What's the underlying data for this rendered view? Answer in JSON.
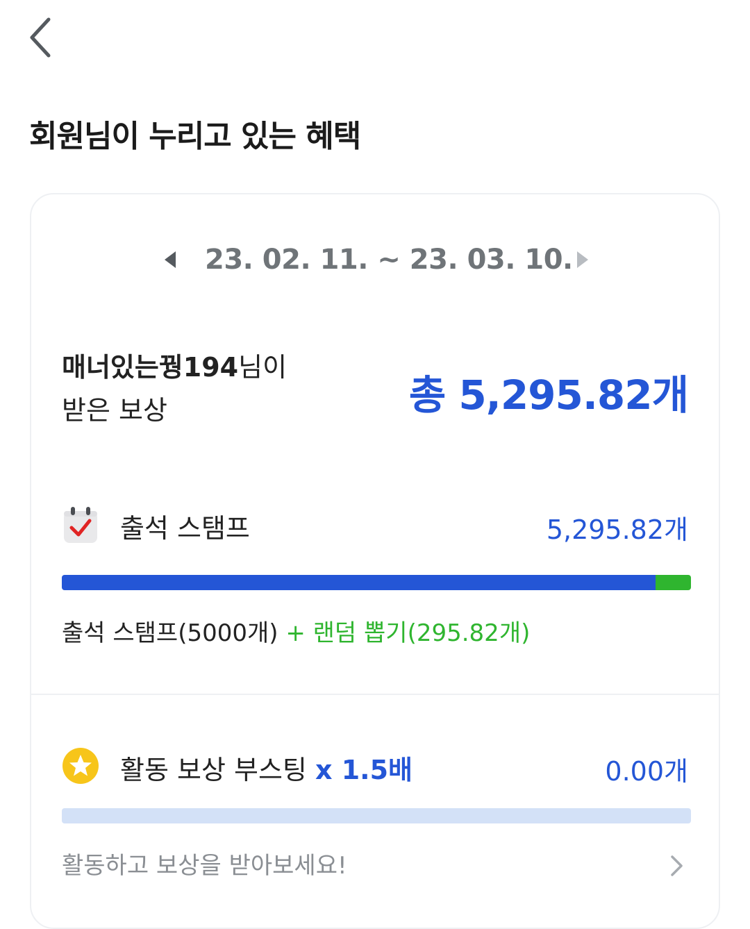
{
  "header": {
    "back_icon": "chevron-left-icon",
    "title": "회원님이 누리고 있는 혜택"
  },
  "period": {
    "prev_icon": "caret-left-icon",
    "next_icon": "caret-right-icon",
    "range": "23. 02. 11. ~ 23. 03. 10."
  },
  "summary": {
    "nickname": "매너있는꿩194",
    "suffix": "님이",
    "line2": "받은 보상",
    "total": "총 5,295.82개"
  },
  "attendance": {
    "icon": "calendar-check-icon",
    "label": "출석 스탬프",
    "value": "5,295.82개",
    "progress_stamp_fraction": 0.944,
    "progress_random_fraction": 0.056,
    "breakdown_base": "출석 스탬프(5000개)",
    "breakdown_bonus": "+ 랜덤 뽑기(295.82개)"
  },
  "boost": {
    "icon": "star-icon",
    "label": "활동 보상 부스팅",
    "multiplier": "x 1.5배",
    "value": "0.00개",
    "progress_fraction": 0,
    "cta": "활동하고 보상을 받아보세요!",
    "cta_icon": "chevron-right-icon"
  },
  "colors": {
    "accent_blue": "#2456d6",
    "bonus_green": "#2fb52f",
    "track_light": "#d3e1f7",
    "muted_text": "#8a8e93"
  }
}
